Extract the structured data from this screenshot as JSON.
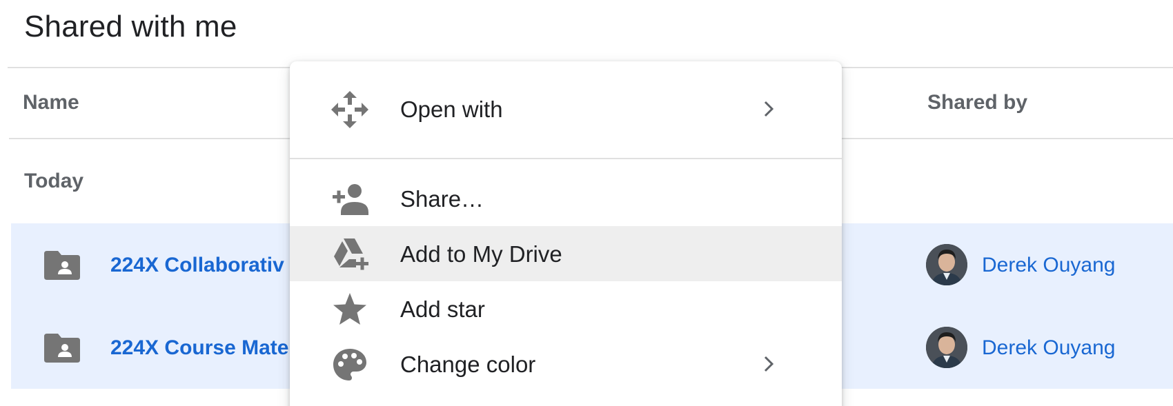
{
  "page": {
    "title": "Shared with me"
  },
  "table": {
    "columns": {
      "name": "Name",
      "shared_by": "Shared by"
    },
    "group_label": "Today",
    "rows": [
      {
        "name": "224X Collaborativ",
        "shared_by": "Derek Ouyang",
        "icon": "shared-folder-icon"
      },
      {
        "name": "224X Course Mate",
        "shared_by": "Derek Ouyang",
        "icon": "shared-folder-icon"
      }
    ]
  },
  "context_menu": {
    "items": [
      {
        "label": "Open with",
        "icon": "open-with-icon",
        "has_submenu": true
      },
      {
        "label": "Share…",
        "icon": "add-person-icon",
        "has_submenu": false
      },
      {
        "label": "Add to My Drive",
        "icon": "add-to-drive-icon",
        "has_submenu": false,
        "highlighted": true
      },
      {
        "label": "Add star",
        "icon": "star-icon",
        "has_submenu": false
      },
      {
        "label": "Change color",
        "icon": "palette-icon",
        "has_submenu": true
      }
    ]
  },
  "colors": {
    "link": "#1967d2",
    "selection": "#e8f0fe",
    "icon_gray": "#757575",
    "hover": "#eeeeee"
  }
}
